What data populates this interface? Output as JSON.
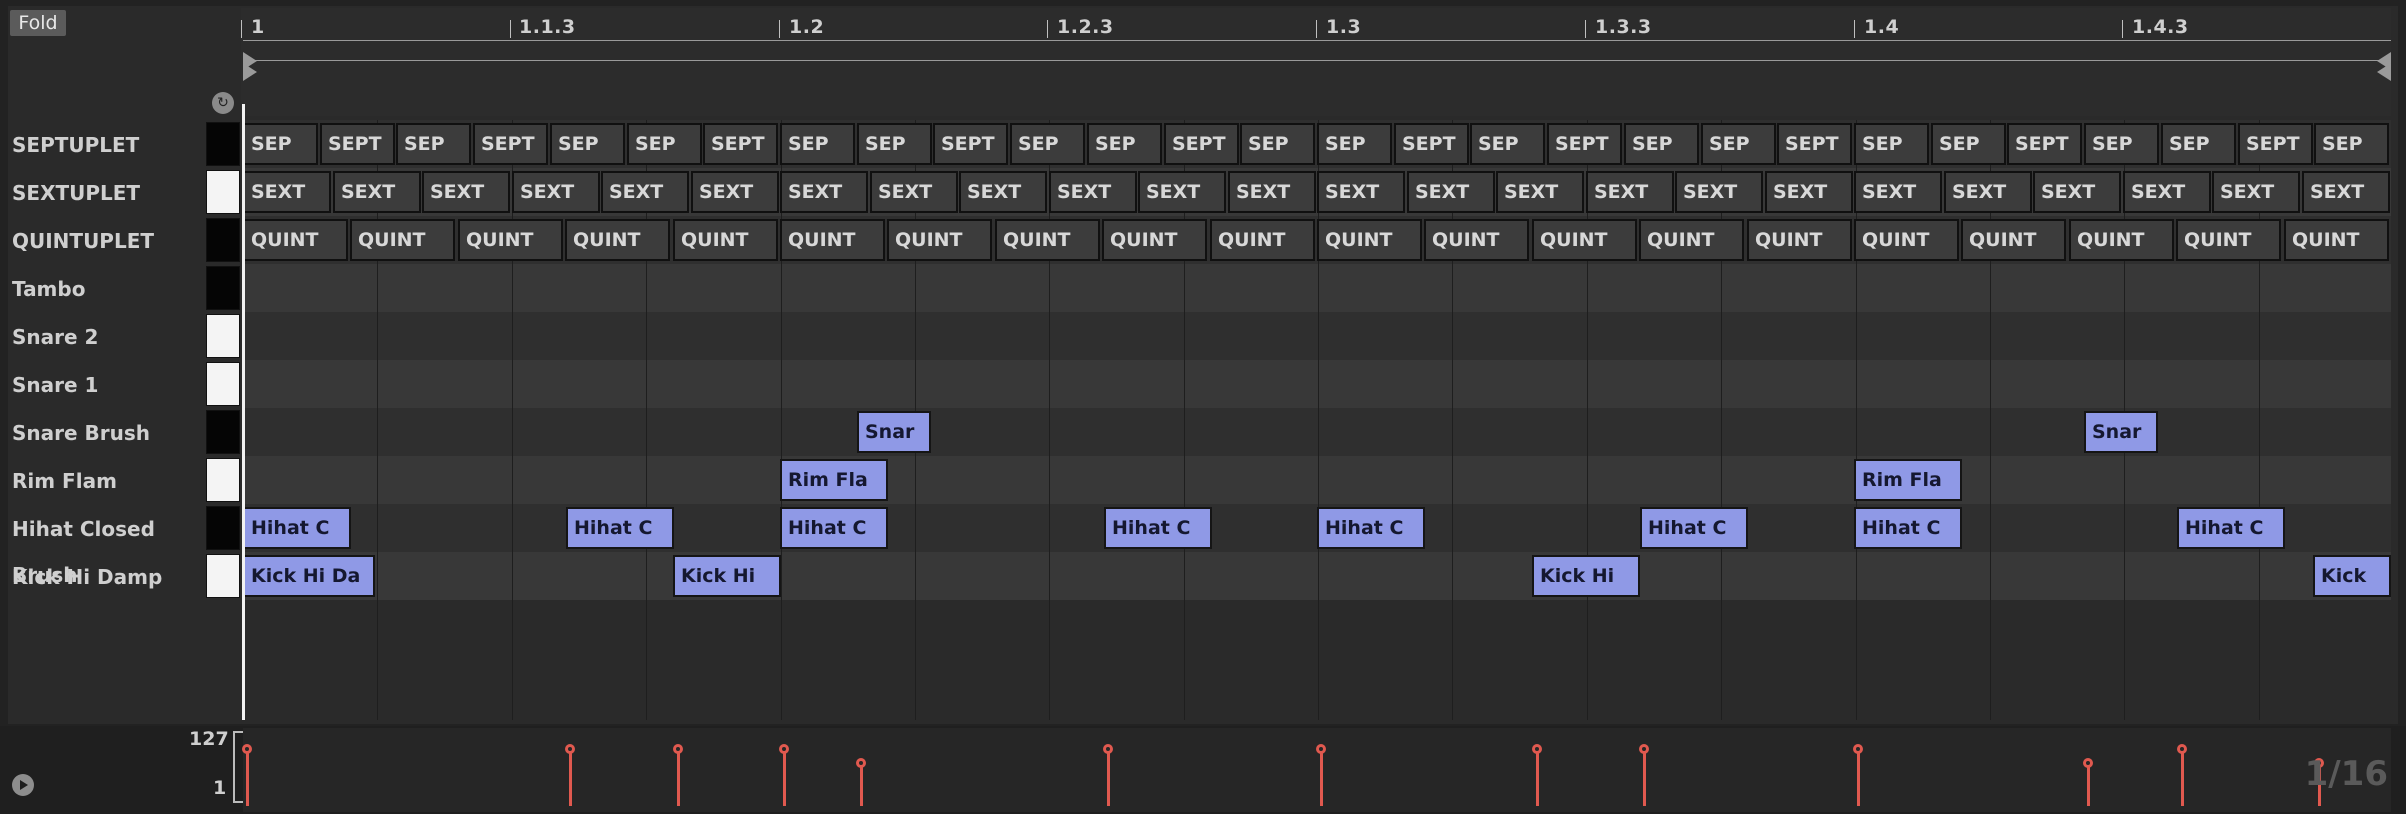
{
  "header": {
    "fold_label": "Fold"
  },
  "ruler": {
    "labels": [
      "1",
      "1.1.3",
      "1.2",
      "1.2.3",
      "1.3",
      "1.3.3",
      "1.4",
      "1.4.3"
    ]
  },
  "lanes": [
    {
      "name": "SEPTUPLET",
      "key": "black"
    },
    {
      "name": "SEXTUPLET",
      "key": "white"
    },
    {
      "name": "QUINTUPLET",
      "key": "black"
    },
    {
      "name": "Tambo",
      "key": "black"
    },
    {
      "name": "Snare 2",
      "key": "white"
    },
    {
      "name": "Snare 1",
      "key": "white"
    },
    {
      "name": "Snare Brush",
      "key": "black"
    },
    {
      "name": "Rim Flam",
      "key": "white"
    },
    {
      "name": "Hihat Closed Brush",
      "key": "black"
    },
    {
      "name": "Kick Hi Damp",
      "key": "white"
    }
  ],
  "notes": {
    "septuplet": [
      "SEP",
      "SEPT",
      "SEP",
      "SEPT",
      "SEP",
      "SEP",
      "SEPT",
      "SEP",
      "SEP",
      "SEPT",
      "SEP",
      "SEP",
      "SEPT",
      "SEP",
      "SEP",
      "SEPT",
      "SEP",
      "SEPT",
      "SEP",
      "SEP",
      "SEPT",
      "SEP",
      "SEP",
      "SEPT",
      "SEP",
      "SEP",
      "SEPT",
      "SEP"
    ],
    "sextuplet": [
      "SEXT",
      "SEXT",
      "SEXT",
      "SEXT",
      "SEXT",
      "SEXT",
      "SEXT",
      "SEXT",
      "SEXT",
      "SEXT",
      "SEXT",
      "SEXT",
      "SEXT",
      "SEXT",
      "SEXT",
      "SEXT",
      "SEXT",
      "SEXT",
      "SEXT",
      "SEXT",
      "SEXT",
      "SEXT",
      "SEXT",
      "SEXT"
    ],
    "quintuplet": [
      "QUINT",
      "QUINT",
      "QUINT",
      "QUINT",
      "QUINT",
      "QUINT",
      "QUINT",
      "QUINT",
      "QUINT",
      "QUINT",
      "QUINT",
      "QUINT",
      "QUINT",
      "QUINT",
      "QUINT",
      "QUINT",
      "QUINT",
      "QUINT",
      "QUINT",
      "QUINT"
    ],
    "snare_brush": [
      "Snar",
      "Snar"
    ],
    "rim_flam": [
      "Rim Fla",
      "Rim Fla"
    ],
    "hihat": [
      "Hihat C",
      "Hihat C",
      "Hihat C",
      "Hihat C",
      "Hihat C",
      "Hihat C",
      "Hihat C",
      "Hihat C"
    ],
    "kick": [
      "Kick Hi Da",
      "Kick Hi",
      "Kick Hi",
      "Kick"
    ]
  },
  "velocity": {
    "max_label": "127",
    "min_label": "1",
    "quantization": "1/16"
  }
}
